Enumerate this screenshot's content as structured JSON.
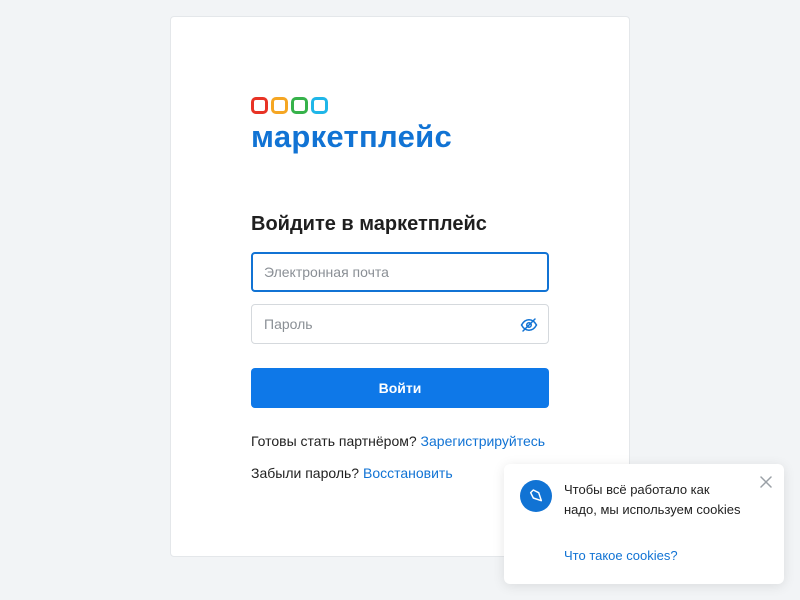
{
  "brand": {
    "name": "маркетплейс",
    "accent": "#1173d4",
    "logo_colors": [
      "#e83325",
      "#f5a623",
      "#36b24a",
      "#1fb6e8"
    ]
  },
  "login": {
    "title": "Войдите в маркетплейс",
    "email_placeholder": "Электронная почта",
    "email_value": "",
    "password_placeholder": "Пароль",
    "password_value": "",
    "password_toggle_icon": "eye-off-icon",
    "submit_label": "Войти",
    "button_color": "#0e78e8"
  },
  "links": {
    "partner_text": "Готовы стать партнёром?",
    "partner_link": "Зарегистрируйтесь",
    "forgot_text": "Забыли пароль?",
    "forgot_link": "Восстановить"
  },
  "cookie_banner": {
    "icon": "cookie-icon",
    "message": "Чтобы всё работало как надо, мы используем cookies",
    "link": "Что такое cookies?",
    "close_icon": "close-icon"
  }
}
